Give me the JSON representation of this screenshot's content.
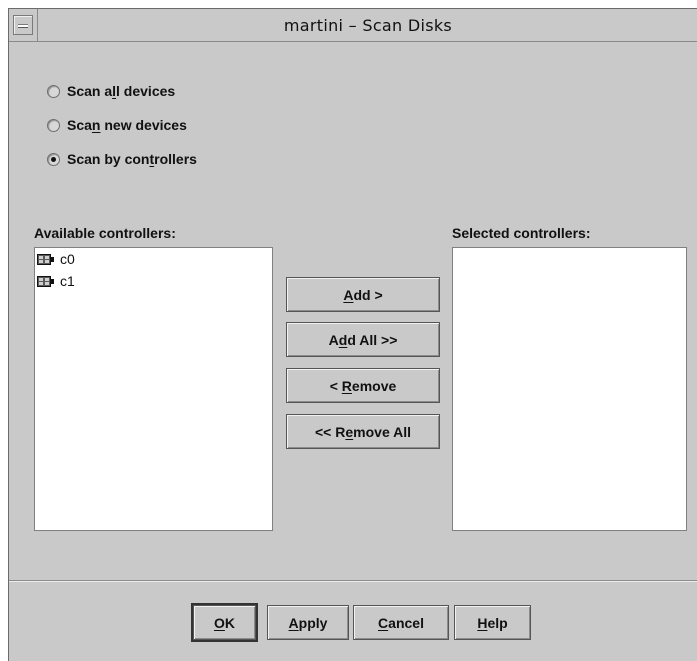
{
  "window": {
    "title": "martini – Scan Disks"
  },
  "scan_options": [
    {
      "label_pre": "Scan a",
      "label_mn": "l",
      "label_post": "l devices",
      "checked": false
    },
    {
      "label_pre": "Sca",
      "label_mn": "n",
      "label_post": " new devices",
      "checked": false
    },
    {
      "label_pre": "Scan by con",
      "label_mn": "t",
      "label_post": "rollers",
      "checked": true
    }
  ],
  "available": {
    "label": "Available controllers:",
    "items": [
      "c0",
      "c1"
    ]
  },
  "selected": {
    "label": "Selected controllers:",
    "items": []
  },
  "transfer_buttons": {
    "add": {
      "pre": "",
      "mn": "A",
      "post": "dd >"
    },
    "add_all": {
      "pre": "A",
      "mn": "d",
      "post": "d All >>"
    },
    "remove": {
      "pre": "< ",
      "mn": "R",
      "post": "emove"
    },
    "remove_all": {
      "pre": "<< R",
      "mn": "e",
      "post": "move All"
    }
  },
  "footer_buttons": {
    "ok": {
      "pre": "",
      "mn": "O",
      "post": "K"
    },
    "apply": {
      "pre": "",
      "mn": "A",
      "post": "pply"
    },
    "cancel": {
      "pre": "",
      "mn": "C",
      "post": "ancel"
    },
    "help": {
      "pre": "",
      "mn": "H",
      "post": "elp"
    }
  },
  "icons": {
    "menu": "window-menu-icon",
    "controller": "disk-controller-icon"
  }
}
